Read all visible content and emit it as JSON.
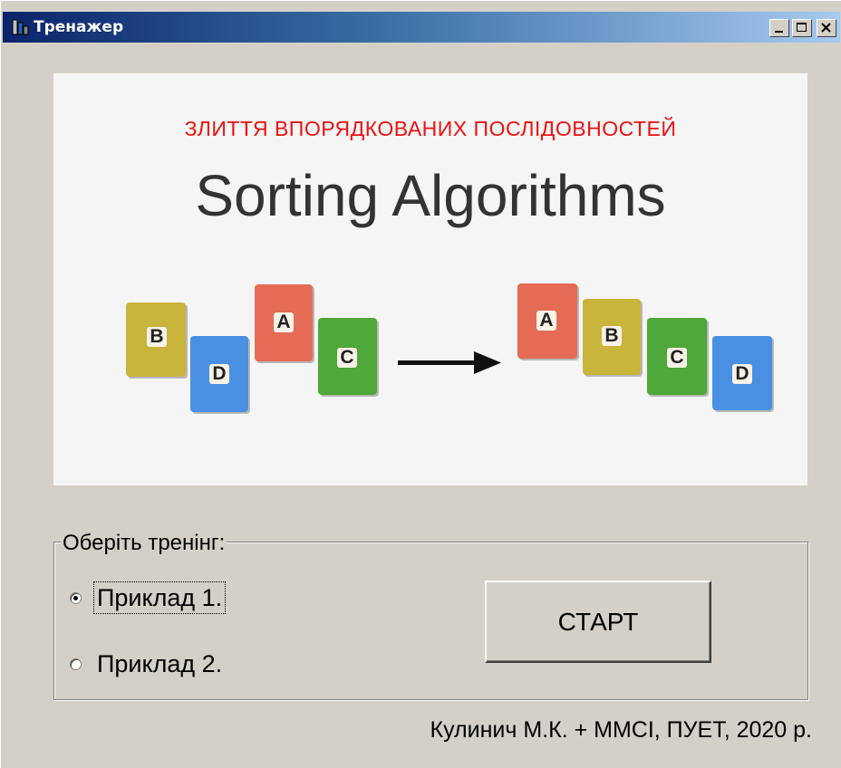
{
  "window": {
    "title": "Тренажер",
    "buttons": {
      "minimize": "minimize",
      "maximize": "maximize",
      "close": "close"
    }
  },
  "banner": {
    "subtitle": "ЗЛИТТЯ ВПОРЯДКОВАНИХ ПОСЛІДОВНОСТЕЙ",
    "title": "Sorting Algorithms",
    "unsorted": [
      "B",
      "D",
      "A",
      "C"
    ],
    "sorted": [
      "A",
      "B",
      "C",
      "D"
    ]
  },
  "training": {
    "legend": "Оберіть тренінг:",
    "options": [
      {
        "label": "Приклад 1.",
        "selected": true
      },
      {
        "label": "Приклад 2.",
        "selected": false
      }
    ],
    "start_label": "СТАРТ"
  },
  "footer": {
    "text": "Кулинич М.К. +  ММСІ, ПУЕТ, 2020 р."
  },
  "colors": {
    "subtitle": "#ee1111",
    "card_yellow": "#c9b43c",
    "card_blue": "#4a90e2",
    "card_red": "#e56b55",
    "card_green": "#4ea83a"
  }
}
